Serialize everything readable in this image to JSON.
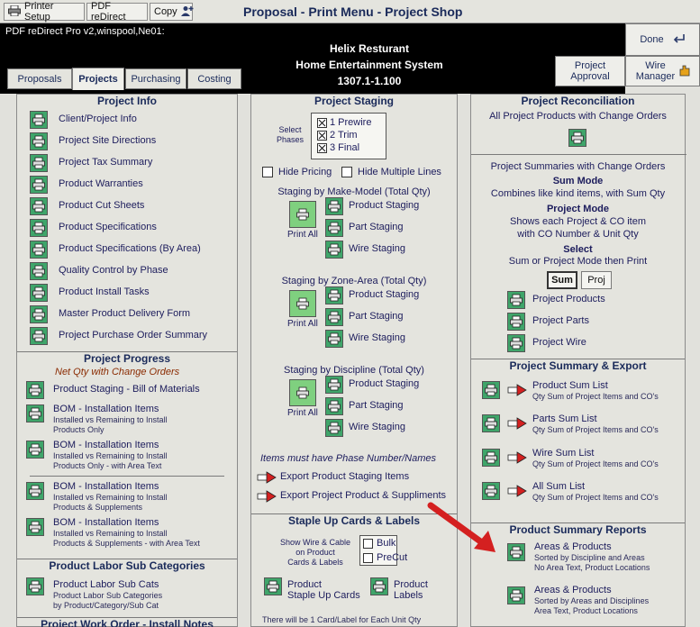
{
  "window": {
    "title": "Proposal - Print Menu - Project Shop"
  },
  "toolbar": {
    "printer_setup": "Printer Setup",
    "pdf_redirect": "PDF reDirect",
    "copy": "Copy"
  },
  "header": {
    "pdf_status": "PDF reDirect Pro v2,winspool,Ne01:",
    "client_name": "Helix Resturant",
    "system_name": "Home Entertainment System",
    "project_number": "1307.1-1.100",
    "done": "Done",
    "project_approval": "Project Approval",
    "wire_manager": "Wire Manager"
  },
  "tabs": [
    {
      "label": "Proposals"
    },
    {
      "label": "Projects"
    },
    {
      "label": "Purchasing"
    },
    {
      "label": "Costing"
    }
  ],
  "project_info": {
    "title": "Project Info",
    "items": [
      "Client/Project Info",
      "Project Site Directions",
      "Project Tax Summary",
      "Product Warranties",
      "Product Cut Sheets",
      "Product Specifications",
      "Product Specifications (By Area)",
      "Quality Control by Phase",
      "Product Install Tasks",
      "Master Product Delivery Form",
      "Project Purchase Order Summary"
    ]
  },
  "project_progress": {
    "title": "Project Progress",
    "subtitle": "Net Qty with Change Orders",
    "bill": "Product Staging - Bill of Materials",
    "bom": [
      {
        "t": "BOM - Installation Items",
        "s1": "Installed vs Remaining to Install",
        "s2": "Products Only"
      },
      {
        "t": "BOM - Installation Items",
        "s1": "Installed vs Remaining to Install",
        "s2": "Products Only - with Area Text"
      },
      {
        "t": "BOM - Installation Items",
        "s1": "Installed vs Remaining to Install",
        "s2": "Products & Supplements"
      },
      {
        "t": "BOM - Installation Items",
        "s1": "Installed vs Remaining to Install",
        "s2": "Products & Supplements - with Area Text"
      }
    ]
  },
  "labor": {
    "title": "Product Labor Sub Categories",
    "item": "Product Labor Sub Cats",
    "s1": "Product Labor Sub Categories",
    "s2": "by Product/Category/Sub Cat"
  },
  "work_order": {
    "title": "Project Work Order - Install Notes"
  },
  "staging": {
    "title": "Project Staging",
    "select_phases": "Select Phases",
    "phases": [
      "1 Prewire",
      "2 Trim",
      "3 Final"
    ],
    "hide_pricing": "Hide Pricing",
    "hide_multiple": "Hide Multiple Lines",
    "groups": [
      {
        "title": "Staging by Make-Model (Total Qty)"
      },
      {
        "title": "Staging by Zone-Area (Total Qty)"
      },
      {
        "title": "Staging by Discipline (Total Qty)"
      }
    ],
    "print_all": "Print All",
    "product_staging": "Product Staging",
    "part_staging": "Part Staging",
    "wire_staging": "Wire Staging",
    "note": "Items must have Phase Number/Names",
    "export1": "Export Product Staging Items",
    "export2": "Export Project Product & Suppliments"
  },
  "staple": {
    "title": "Staple Up Cards & Labels",
    "show_l1": "Show Wire & Cable",
    "show_l2": "on Product",
    "show_l3": "Cards & Labels",
    "bulk": "Bulk",
    "precut": "PreCut",
    "cards_l1": "Product",
    "cards_l2": "Staple Up Cards",
    "labels_l1": "Product",
    "labels_l2": "Labels",
    "footer": "There will be 1 Card/Label for Each Unit Qty"
  },
  "reconciliation": {
    "title": "Project Reconciliation",
    "all_co": "All Project Products with Change Orders",
    "summaries": "Project Summaries with Change Orders",
    "sum_mode": "Sum Mode",
    "sum_desc": "Combines like kind items, with Sum Qty",
    "proj_mode": "Project Mode",
    "proj_desc1": "Shows each Project & CO item",
    "proj_desc2": "with CO Number & Unit Qty",
    "select": "Select",
    "select_desc": "Sum or Project Mode then Print",
    "sum_btn": "Sum",
    "proj_btn": "Proj",
    "items": [
      "Project Products",
      "Project Parts",
      "Project Wire"
    ]
  },
  "summary_export": {
    "title": "Project Summary & Export",
    "items": [
      {
        "t": "Product Sum List",
        "s": "Qty Sum of Project Items and CO's"
      },
      {
        "t": "Parts Sum List",
        "s": "Qty Sum of Project Items and CO's"
      },
      {
        "t": "Wire Sum List",
        "s": "Qty Sum of Project Items and CO's"
      },
      {
        "t": "All Sum List",
        "s": "Qty Sum of Project Items and CO's"
      }
    ]
  },
  "reports": {
    "title": "Product Summary Reports",
    "items": [
      {
        "t": "Areas & Products",
        "s1": "Sorted by Discipline and Areas",
        "s2": "No Area Text, Product Locations"
      },
      {
        "t": "Areas & Products",
        "s1": "Sorted by Areas and Disciplines",
        "s2": "Area Text, Product Locations"
      }
    ]
  },
  "colors": {
    "accent": "#1a2a5a",
    "printer_green": "#3fa56a",
    "arrow_red": "#d42020"
  }
}
